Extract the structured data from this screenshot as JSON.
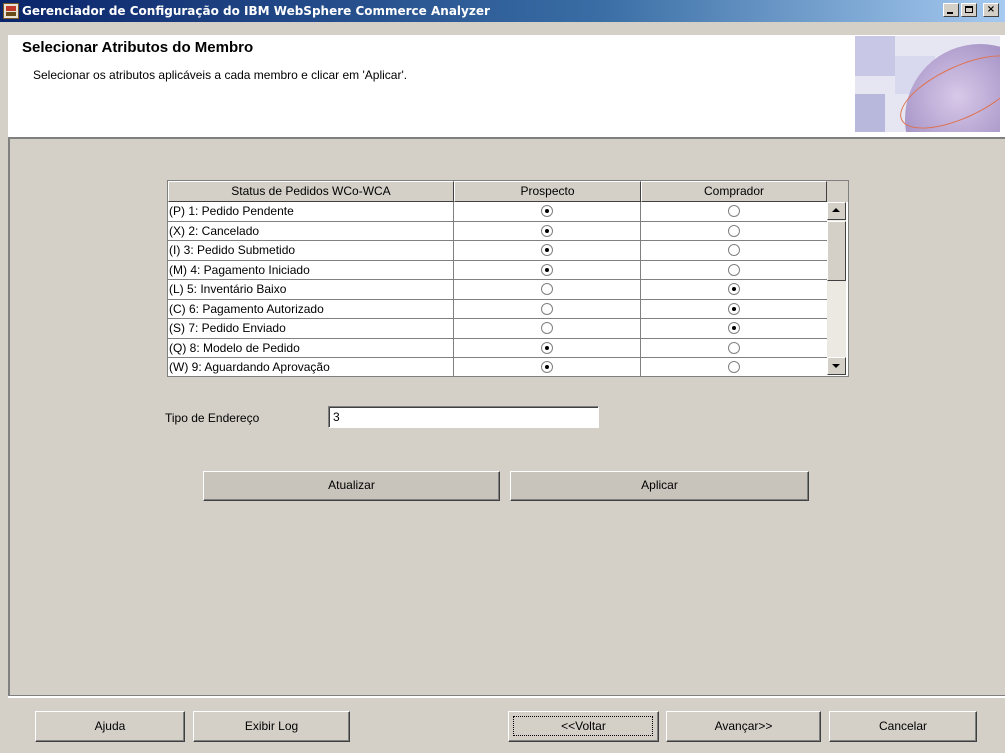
{
  "window": {
    "title": "Gerenciador de Configuração do IBM WebSphere Commerce Analyzer"
  },
  "header": {
    "title": "Selecionar Atributos do Membro",
    "description": "Selecionar os atributos aplicáveis a cada membro e clicar em 'Aplicar'."
  },
  "table": {
    "columns": [
      "Status de Pedidos WCo-WCA",
      "Prospecto",
      "Comprador"
    ],
    "rows": [
      {
        "label": "(P) 1: Pedido Pendente",
        "selected": "Prospecto"
      },
      {
        "label": "(X) 2: Cancelado",
        "selected": "Prospecto"
      },
      {
        "label": "(I) 3: Pedido Submetido",
        "selected": "Prospecto"
      },
      {
        "label": "(M) 4: Pagamento Iniciado",
        "selected": "Prospecto"
      },
      {
        "label": "(L) 5: Inventário Baixo",
        "selected": "Comprador"
      },
      {
        "label": "(C) 6: Pagamento Autorizado",
        "selected": "Comprador"
      },
      {
        "label": "(S) 7: Pedido Enviado",
        "selected": "Comprador"
      },
      {
        "label": "(Q) 8: Modelo de Pedido",
        "selected": "Prospecto"
      },
      {
        "label": "(W) 9: Aguardando Aprovação",
        "selected": "Prospecto"
      }
    ]
  },
  "address": {
    "label": "Tipo de Endereço",
    "value": "3"
  },
  "actions": {
    "update_label": "Atualizar",
    "apply_label": "Aplicar"
  },
  "footer": {
    "help_label": "Ajuda",
    "log_label": "Exibir Log",
    "back_label": "<<Voltar",
    "next_label": "Avançar>>",
    "cancel_label": "Cancelar"
  }
}
